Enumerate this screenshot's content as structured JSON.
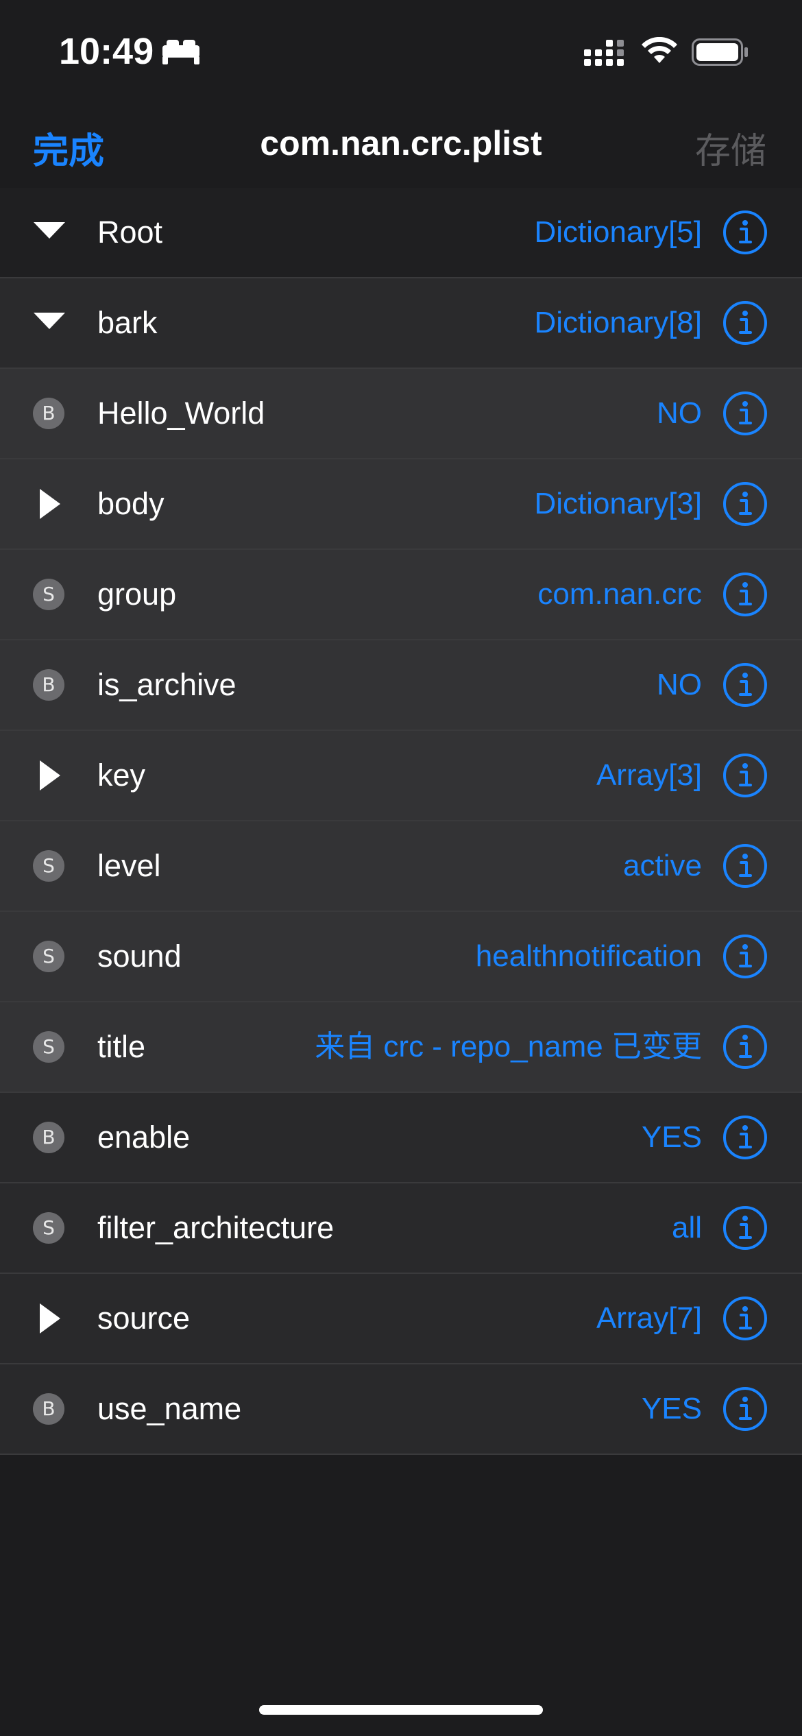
{
  "status_bar": {
    "time": "10:49",
    "icons": [
      "bed-icon",
      "signal-icon",
      "wifi-icon",
      "battery-icon"
    ]
  },
  "nav": {
    "done_label": "完成",
    "title": "com.nan.crc.plist",
    "save_label": "存储"
  },
  "colors": {
    "accent": "#1a84ff",
    "background": "#1c1c1e",
    "separator": "#3a3a3c",
    "disabled": "#5b5b5e"
  },
  "rows": [
    {
      "key": "Root",
      "value": "Dictionary[5]",
      "type": "expanded"
    },
    {
      "key": "bark",
      "value": "Dictionary[8]",
      "type": "expanded"
    },
    {
      "key": "Hello_World",
      "value": "NO",
      "type": "B"
    },
    {
      "key": "body",
      "value": "Dictionary[3]",
      "type": "collapsed"
    },
    {
      "key": "group",
      "value": "com.nan.crc",
      "type": "S"
    },
    {
      "key": "is_archive",
      "value": "NO",
      "type": "B"
    },
    {
      "key": "key",
      "value": "Array[3]",
      "type": "collapsed"
    },
    {
      "key": "level",
      "value": "active",
      "type": "S"
    },
    {
      "key": "sound",
      "value": "healthnotification",
      "type": "S"
    },
    {
      "key": "title",
      "value": "来自 crc - repo_name 已变更",
      "type": "S"
    },
    {
      "key": "enable",
      "value": "YES",
      "type": "B"
    },
    {
      "key": "filter_architecture",
      "value": "all",
      "type": "S"
    },
    {
      "key": "source",
      "value": "Array[7]",
      "type": "collapsed"
    },
    {
      "key": "use_name",
      "value": "YES",
      "type": "B"
    }
  ]
}
